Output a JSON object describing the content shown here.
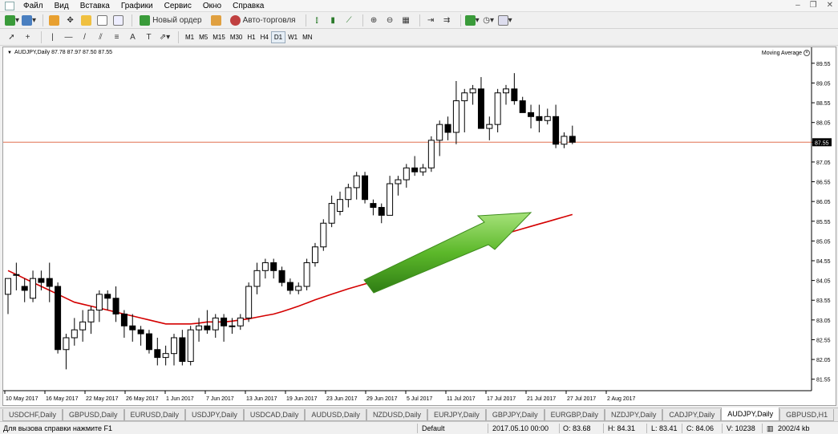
{
  "menu": [
    "Файл",
    "Вид",
    "Вставка",
    "Графики",
    "Сервис",
    "Окно",
    "Справка"
  ],
  "toolbar": {
    "new_order": "Новый ордер",
    "autotrading": "Авто-торговля"
  },
  "timeframes": [
    "M1",
    "M5",
    "M15",
    "M30",
    "H1",
    "H4",
    "D1",
    "W1",
    "MN"
  ],
  "chart": {
    "header": "AUDJPY,Daily  87.78 87.97 87.50 87.55",
    "indicator": "Moving Average",
    "current_price": "87.55",
    "colors": {
      "ma": "#d40000",
      "price_line": "#e07050",
      "arrow": "#5cb82a",
      "bull": "#ffffff",
      "bear": "#000000"
    }
  },
  "chart_data": {
    "type": "candlestick",
    "title": "AUDJPY,Daily",
    "y_ticks": [
      "89.55",
      "89.05",
      "88.55",
      "88.05",
      "87.55",
      "87.05",
      "86.55",
      "86.05",
      "85.55",
      "85.05",
      "84.55",
      "84.05",
      "83.55",
      "83.05",
      "82.55",
      "82.05",
      "81.55"
    ],
    "x_ticks": [
      "10 May 2017",
      "16 May 2017",
      "22 May 2017",
      "26 May 2017",
      "1 Jun 2017",
      "7 Jun 2017",
      "13 Jun 2017",
      "19 Jun 2017",
      "23 Jun 2017",
      "29 Jun 2017",
      "5 Jul 2017",
      "11 Jul 2017",
      "17 Jul 2017",
      "21 Jul 2017",
      "27 Jul 2017",
      "2 Aug 2017"
    ],
    "ylim": [
      81.3,
      89.75
    ],
    "candles": [
      [
        83.7,
        84.0,
        83.2,
        84.1
      ],
      [
        84.2,
        84.5,
        83.8,
        84.2
      ],
      [
        83.9,
        84.1,
        83.5,
        83.8
      ],
      [
        83.6,
        84.3,
        83.5,
        84.1
      ],
      [
        84.1,
        84.3,
        83.8,
        84.0
      ],
      [
        84.1,
        84.5,
        83.5,
        83.9
      ],
      [
        83.9,
        84.0,
        82.2,
        82.3
      ],
      [
        82.3,
        82.7,
        81.8,
        82.6
      ],
      [
        82.6,
        83.1,
        82.4,
        82.8
      ],
      [
        82.8,
        83.3,
        82.5,
        83.0
      ],
      [
        83.0,
        83.4,
        82.7,
        83.3
      ],
      [
        83.3,
        83.8,
        83.0,
        83.7
      ],
      [
        83.7,
        83.8,
        83.3,
        83.6
      ],
      [
        83.6,
        83.9,
        83.0,
        83.2
      ],
      [
        83.2,
        83.3,
        82.6,
        82.9
      ],
      [
        82.9,
        83.2,
        82.5,
        82.8
      ],
      [
        82.8,
        82.9,
        82.4,
        82.7
      ],
      [
        82.7,
        82.8,
        82.2,
        82.3
      ],
      [
        82.3,
        82.6,
        81.9,
        82.1
      ],
      [
        82.1,
        82.4,
        81.9,
        82.2
      ],
      [
        82.2,
        82.7,
        81.9,
        82.6
      ],
      [
        82.6,
        82.8,
        81.9,
        82.0
      ],
      [
        82.0,
        82.9,
        81.9,
        82.8
      ],
      [
        82.8,
        83.1,
        82.5,
        82.9
      ],
      [
        82.9,
        83.3,
        82.7,
        82.8
      ],
      [
        82.8,
        83.2,
        82.6,
        83.1
      ],
      [
        83.1,
        83.2,
        82.5,
        82.9
      ],
      [
        82.9,
        83.1,
        82.7,
        82.9
      ],
      [
        82.9,
        83.2,
        82.8,
        83.1
      ],
      [
        83.1,
        84.0,
        83.0,
        83.9
      ],
      [
        83.9,
        84.5,
        83.7,
        84.3
      ],
      [
        84.3,
        84.6,
        84.1,
        84.5
      ],
      [
        84.5,
        84.6,
        84.1,
        84.3
      ],
      [
        84.3,
        84.4,
        83.9,
        84.0
      ],
      [
        84.0,
        84.1,
        83.7,
        83.8
      ],
      [
        83.8,
        84.0,
        83.7,
        83.9
      ],
      [
        83.9,
        84.6,
        83.8,
        84.5
      ],
      [
        84.5,
        85.0,
        84.4,
        84.9
      ],
      [
        84.9,
        85.6,
        84.8,
        85.5
      ],
      [
        85.5,
        86.2,
        85.4,
        86.0
      ],
      [
        85.8,
        86.3,
        85.7,
        86.1
      ],
      [
        86.1,
        86.5,
        85.9,
        86.4
      ],
      [
        86.4,
        86.8,
        86.1,
        86.7
      ],
      [
        86.7,
        86.8,
        86.0,
        86.1
      ],
      [
        86.0,
        86.1,
        85.7,
        85.9
      ],
      [
        85.9,
        86.0,
        85.5,
        85.7
      ],
      [
        85.7,
        86.7,
        85.7,
        86.5
      ],
      [
        86.5,
        86.7,
        86.2,
        86.6
      ],
      [
        86.6,
        87.0,
        86.4,
        86.9
      ],
      [
        86.9,
        87.2,
        86.7,
        86.8
      ],
      [
        86.8,
        87.0,
        86.7,
        86.9
      ],
      [
        86.9,
        87.7,
        86.8,
        87.6
      ],
      [
        87.6,
        88.1,
        87.2,
        88.0
      ],
      [
        88.0,
        88.2,
        87.6,
        87.8
      ],
      [
        87.8,
        89.1,
        87.5,
        88.6
      ],
      [
        88.6,
        88.9,
        87.8,
        88.8
      ],
      [
        88.8,
        89.0,
        88.5,
        88.9
      ],
      [
        88.9,
        89.2,
        88.5,
        87.9
      ],
      [
        87.9,
        88.2,
        87.6,
        88.0
      ],
      [
        88.0,
        88.9,
        87.8,
        88.8
      ],
      [
        88.8,
        89.0,
        88.5,
        88.9
      ],
      [
        88.9,
        89.3,
        88.5,
        88.6
      ],
      [
        88.6,
        88.7,
        88.3,
        88.3
      ],
      [
        88.3,
        88.5,
        87.9,
        88.2
      ],
      [
        88.2,
        88.5,
        87.8,
        88.1
      ],
      [
        88.1,
        88.4,
        88.0,
        88.2
      ],
      [
        88.2,
        88.5,
        87.4,
        87.5
      ],
      [
        87.5,
        87.8,
        87.4,
        87.7
      ],
      [
        87.7,
        87.97,
        87.5,
        87.55
      ]
    ],
    "ma_values": [
      84.3,
      84.2,
      84.1,
      84.0,
      83.9,
      83.8,
      83.7,
      83.6,
      83.5,
      83.45,
      83.4,
      83.35,
      83.3,
      83.25,
      83.2,
      83.15,
      83.1,
      83.05,
      83.0,
      82.95,
      82.95,
      82.95,
      82.95,
      82.97,
      83.0,
      83.0,
      83.0,
      83.02,
      83.05,
      83.08,
      83.12,
      83.16,
      83.2,
      83.26,
      83.33,
      83.4,
      83.48,
      83.56,
      83.63,
      83.7,
      83.77,
      83.84,
      83.9,
      83.96,
      84.02,
      84.08,
      84.14,
      84.2,
      84.28,
      84.36,
      84.44,
      84.52,
      84.6,
      84.68,
      84.76,
      84.84,
      84.92,
      85.0,
      85.08,
      85.16,
      85.24,
      85.3,
      85.36,
      85.42,
      85.48,
      85.54,
      85.6,
      85.66,
      85.72
    ],
    "grid": false
  },
  "tabs": [
    "USDCHF,Daily",
    "GBPUSD,Daily",
    "EURUSD,Daily",
    "USDJPY,Daily",
    "USDCAD,Daily",
    "AUDUSD,Daily",
    "NZDUSD,Daily",
    "EURJPY,Daily",
    "GBPJPY,Daily",
    "EURGBP,Daily",
    "NZDJPY,Daily",
    "CADJPY,Daily",
    "AUDJPY,Daily",
    "GBPUSD,H1"
  ],
  "active_tab": 12,
  "status": {
    "help": "Для вызова справки нажмите F1",
    "profile": "Default",
    "datetime": "2017.05.10 00:00",
    "open": "O: 83.68",
    "high": "H: 84.31",
    "low": "L: 83.41",
    "close": "C: 84.06",
    "volume": "V: 10238",
    "traffic": "2002/4 kb"
  }
}
